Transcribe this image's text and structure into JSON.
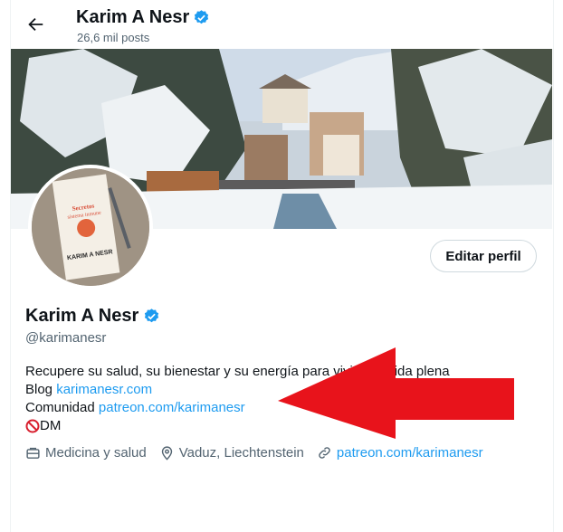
{
  "header": {
    "name": "Karim A Nesr",
    "posts": "26,6 mil posts"
  },
  "avatar": {
    "book_text_top": "Secretos para tener un sistema inmune poderoso ¡y feliz!",
    "book_text_bottom": "KARIM A NESR"
  },
  "edit_button": "Editar perfil",
  "profile": {
    "name": "Karim A Nesr",
    "handle": "@karimanesr"
  },
  "bio": {
    "line1": "Recupere su salud, su bienestar y su energía para vivir una vida plena",
    "blog_label": "Blog ",
    "blog_link": "karimanesr.com",
    "community_label": "Comunidad ",
    "community_link": "patreon.com/karimanesr",
    "dm_text": " DM"
  },
  "meta": {
    "category": "Medicina y salud",
    "location": "Vaduz, Liechtenstein",
    "website": "patreon.com/karimanesr"
  },
  "colors": {
    "accent": "#1d9bf0",
    "arrow": "#e8131b",
    "muted": "#536471"
  }
}
